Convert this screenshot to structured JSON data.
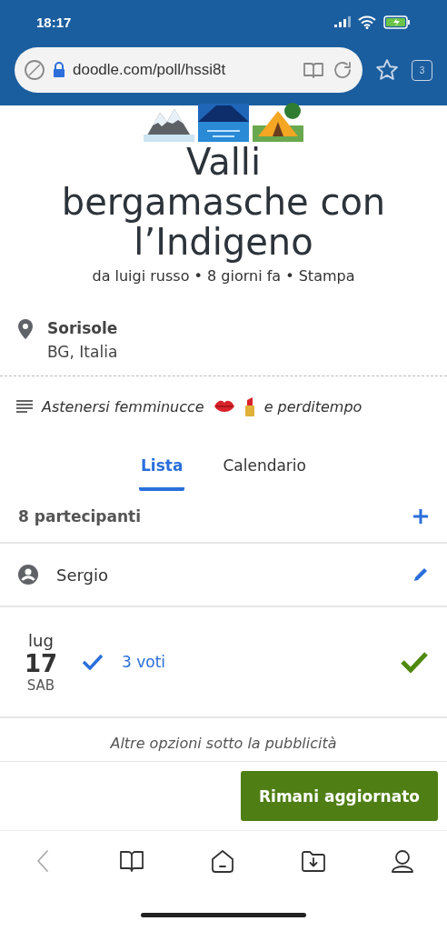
{
  "status_bar": {
    "time": "18:17"
  },
  "browser": {
    "url": "doodle.com/poll/hssi8t",
    "tab_count": "3"
  },
  "poll": {
    "title": "Valli bergamasche con l’Indigeno",
    "meta": "da luigi russo • 8 giorni fa • Stampa",
    "location": {
      "name": "Sorisole",
      "region": "BG, Italia"
    },
    "description": {
      "before": "Astenersi femminucce",
      "after": "e perditempo"
    }
  },
  "tabs": [
    {
      "label": "Lista",
      "selected": true
    },
    {
      "label": "Calendario",
      "selected": false
    }
  ],
  "participants": {
    "count": "8 partecipanti",
    "user": "Sergio"
  },
  "options": [
    {
      "month": "lug",
      "day": "17",
      "weekday": "SAB",
      "votes": "3 voti",
      "my_vote": true
    }
  ],
  "more_note": "Altre opzioni sotto la pubblicità",
  "cta": "Rimani aggiornato"
}
